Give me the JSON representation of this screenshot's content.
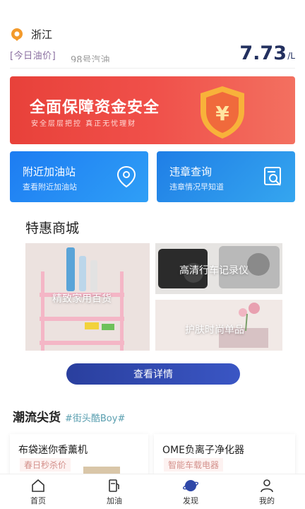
{
  "header": {
    "location": "浙江",
    "price_label": "[今日油价]",
    "fuel_type": "98号汽油",
    "price_value": "7.73",
    "price_unit": "/L"
  },
  "banner": {
    "title": "全面保障资金安全",
    "subtitle": "安全层层把控 真正无忧理财",
    "icon": "shield-yen-icon"
  },
  "services": [
    {
      "title": "附近加油站",
      "subtitle": "查看附近加油站",
      "icon": "location-pin-icon"
    },
    {
      "title": "违章查询",
      "subtitle": "违章情况早知道",
      "icon": "document-search-icon"
    }
  ],
  "mall": {
    "title": "特惠商城",
    "items": [
      {
        "label": "精致家用百货"
      },
      {
        "label": "高清行车记录仪"
      },
      {
        "label": "护肤时尚单品"
      }
    ],
    "detail_button": "查看详情"
  },
  "trend": {
    "title": "潮流尖货",
    "tag": "#街头酷Boy#",
    "cards": [
      {
        "name": "布袋迷你香薰机",
        "tag": "春日秒杀价"
      },
      {
        "name": "OME负离子净化器",
        "tag": "智能车载电器"
      }
    ]
  },
  "tabbar": [
    {
      "label": "首页",
      "icon": "home-icon"
    },
    {
      "label": "加油",
      "icon": "fuel-pump-icon"
    },
    {
      "label": "发现",
      "icon": "discover-icon"
    },
    {
      "label": "我的",
      "icon": "user-icon"
    }
  ],
  "colors": {
    "brand_navy": "#23305f",
    "banner_red": "#e8413a",
    "service_blue": "#1d7cf2",
    "button_indigo": "#2a3f9e"
  }
}
